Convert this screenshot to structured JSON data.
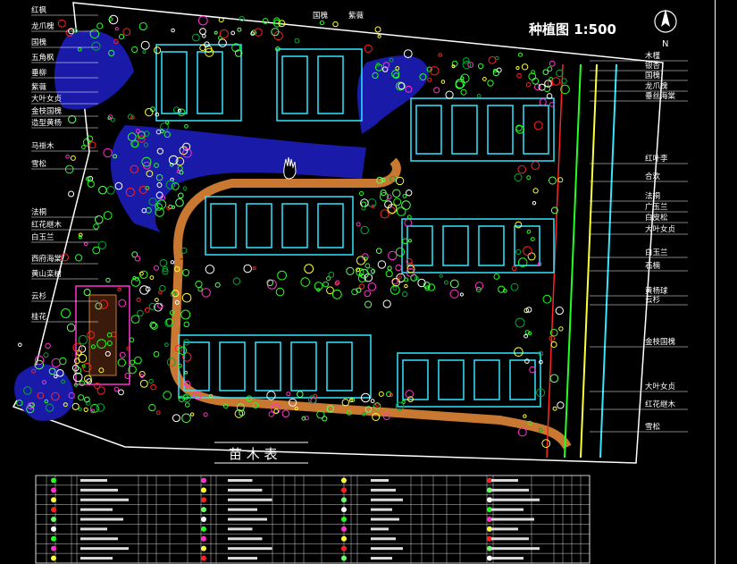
{
  "drawing": {
    "title": "种植图  1:500",
    "north": "N",
    "table_title": "苗  木  表"
  },
  "labels_left": [
    "红枫",
    "龙爪槐",
    "国槐",
    "五角枫",
    "垂柳",
    "紫薇",
    "大叶女贞",
    "金枝国槐",
    "造型黄杨",
    "马褂木",
    "雪松",
    "法桐",
    "红花继木",
    "白玉兰",
    "西府海棠",
    "黄山栾树",
    "云杉",
    "桂花"
  ],
  "labels_top": [
    "国槐",
    "紫薇"
  ],
  "labels_right": [
    "木槿",
    "银杏",
    "国槐",
    "龙爪槐",
    "垂丝海棠",
    "红叶李",
    "合欢",
    "法桐",
    "广玉兰",
    "白皮松",
    "大叶女贞",
    "白玉兰",
    "石楠",
    "黄杨球",
    "云杉",
    "金枝国槐",
    "大叶女贞",
    "红花继木",
    "雪松"
  ],
  "colors": {
    "building": "#33e6ff",
    "green": "#22ff22",
    "road": "#c87830",
    "water": "#1a1aa8",
    "magenta": "#ff33cc",
    "red": "#ff2222",
    "yellow": "#ffff33",
    "white": "#ffffff"
  }
}
